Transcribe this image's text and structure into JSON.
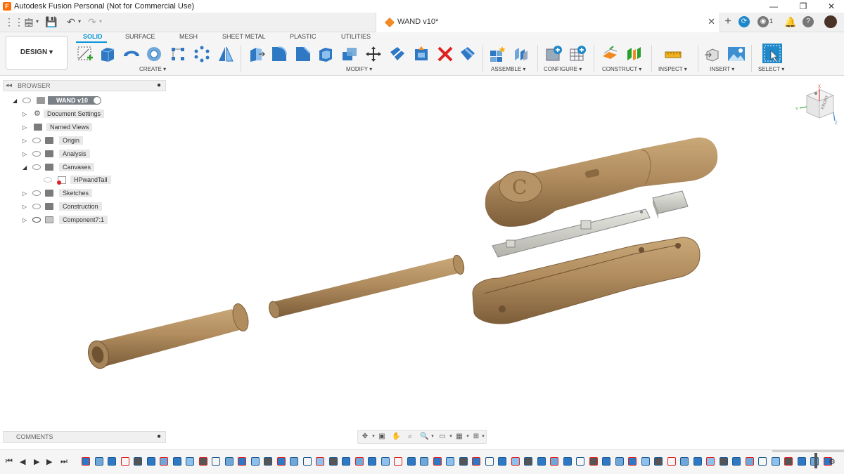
{
  "window": {
    "title": "Autodesk Fusion Personal (Not for Commercial Use)",
    "minimize": "—",
    "maximize": "❐",
    "close": "✕"
  },
  "document": {
    "tab_title": "WAND v10*",
    "close": "✕",
    "notification_count": "1"
  },
  "workspace": {
    "label": "DESIGN ▾"
  },
  "toolbar_tabs": [
    "SOLID",
    "SURFACE",
    "MESH",
    "SHEET METAL",
    "PLASTIC",
    "UTILITIES"
  ],
  "tool_groups": [
    "CREATE ▾",
    "MODIFY ▾",
    "ASSEMBLE ▾",
    "CONFIGURE ▾",
    "CONSTRUCT ▾",
    "INSPECT ▾",
    "INSERT ▾",
    "SELECT ▾"
  ],
  "browser": {
    "header": "BROWSER",
    "root": "WAND v10",
    "items": [
      {
        "label": "Document Settings",
        "expanded": false
      },
      {
        "label": "Named Views",
        "expanded": false
      },
      {
        "label": "Origin",
        "expanded": false
      },
      {
        "label": "Analysis",
        "expanded": false
      },
      {
        "label": "Canvases",
        "expanded": true
      },
      {
        "label": "HPwandTall",
        "expanded": false
      },
      {
        "label": "Sketches",
        "expanded": false
      },
      {
        "label": "Construction",
        "expanded": false
      },
      {
        "label": "Component7:1",
        "expanded": false
      }
    ]
  },
  "viewcube": {
    "face": "FRONT"
  },
  "comments": {
    "header": "COMMENTS"
  },
  "colors": {
    "accent": "#0696d7",
    "wood": "#b08c5e",
    "wood_dark": "#8a6a42",
    "metal": "#c8c8c2"
  }
}
